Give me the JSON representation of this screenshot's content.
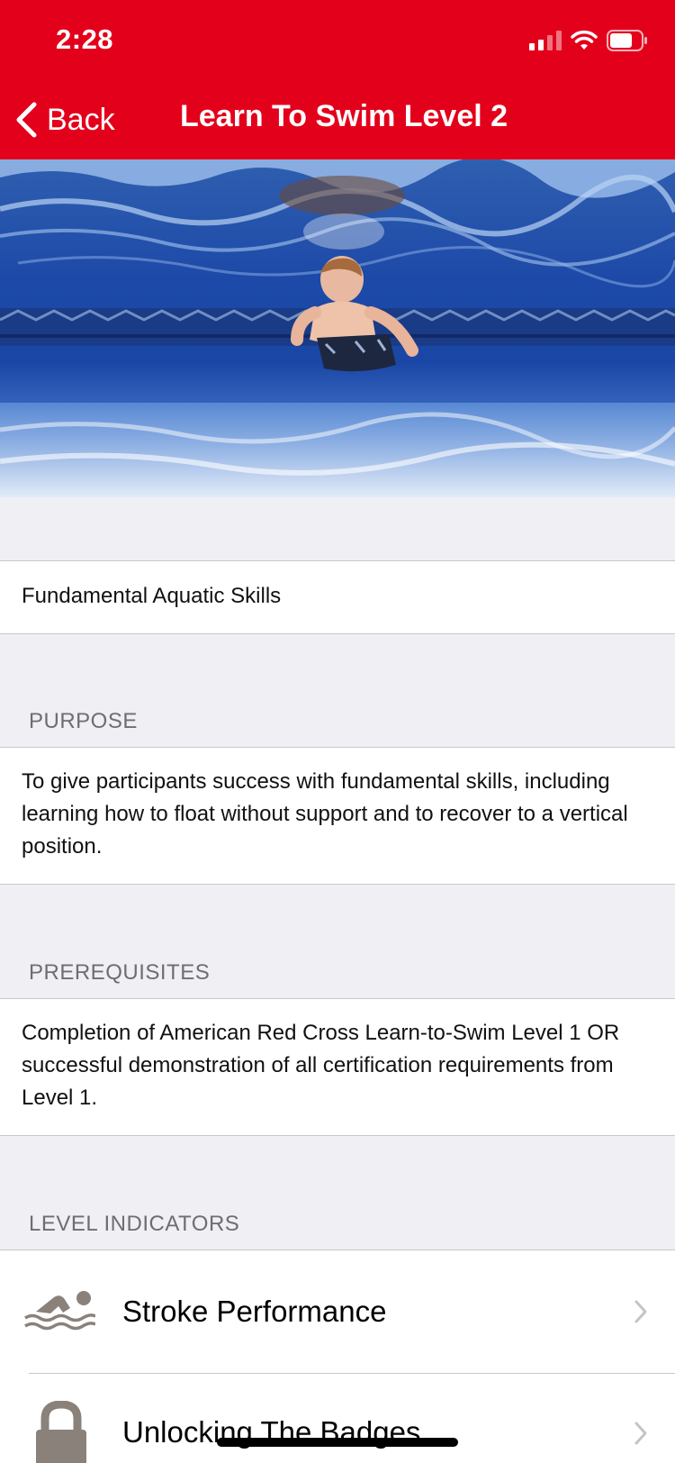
{
  "status_bar": {
    "time": "2:28"
  },
  "nav": {
    "back_label": "Back",
    "title": "Learn To Swim Level 2"
  },
  "subtitle": "Fundamental Aquatic Skills",
  "purpose": {
    "header": "PURPOSE",
    "text": "To give participants success with fundamental skills, including learning how to float without support and to recover to a vertical position."
  },
  "prerequisites": {
    "header": "PREREQUISITES",
    "text": "Completion of American Red Cross Learn-to-Swim Level 1 OR successful demonstration of all certification requirements from Level 1."
  },
  "level_indicators": {
    "header": "LEVEL INDICATORS",
    "items": [
      {
        "label": "Stroke Performance",
        "icon": "swimmer-icon"
      },
      {
        "label": "Unlocking The Badges",
        "icon": "lock-icon"
      }
    ]
  },
  "colors": {
    "header_red": "#e3001b",
    "background": "#efeff4",
    "section_text": "#6d6d72"
  }
}
